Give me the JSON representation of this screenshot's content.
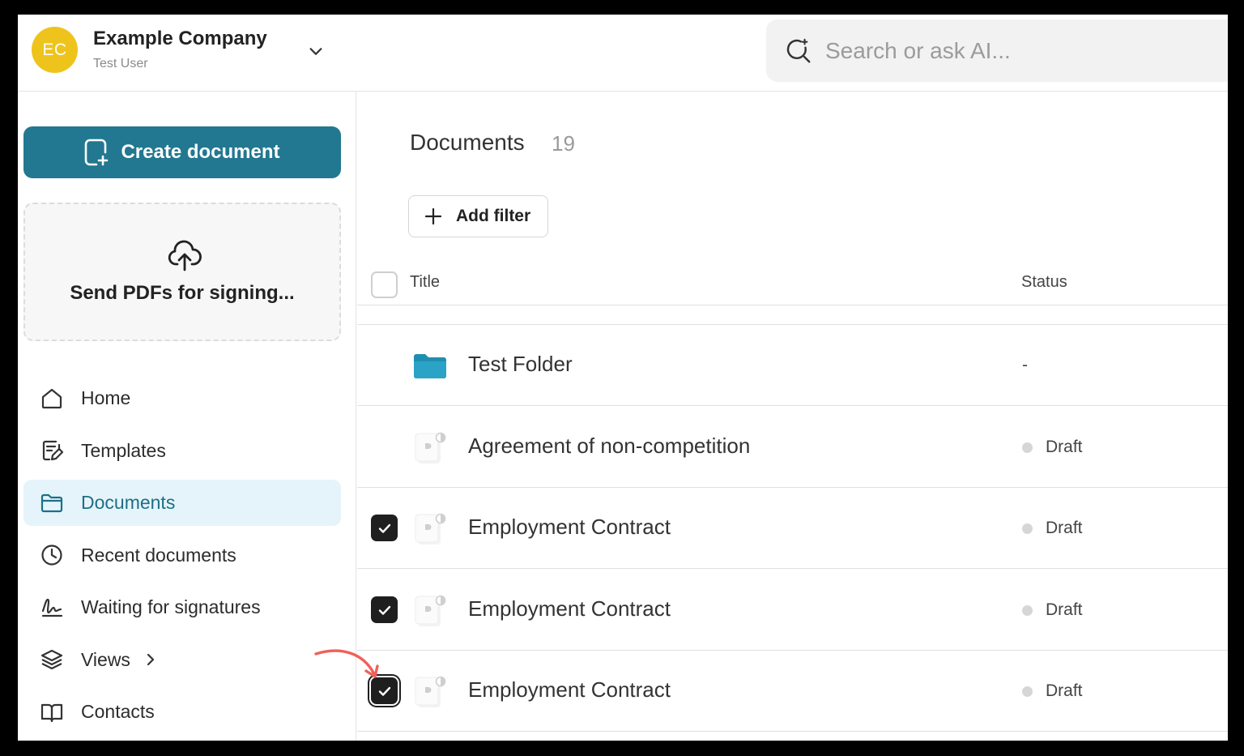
{
  "header": {
    "avatar_initials": "EC",
    "company_name": "Example Company",
    "user_name": "Test User",
    "search_placeholder": "Search or ask AI..."
  },
  "sidebar": {
    "create_label": "Create document",
    "upload_label": "Send PDFs for signing...",
    "nav": [
      {
        "label": "Home",
        "icon": "home-icon",
        "active": false
      },
      {
        "label": "Templates",
        "icon": "templates-icon",
        "active": false
      },
      {
        "label": "Documents",
        "icon": "folder-icon",
        "active": true
      },
      {
        "label": "Recent documents",
        "icon": "clock-icon",
        "active": false
      },
      {
        "label": "Waiting for signatures",
        "icon": "signature-icon",
        "active": false
      },
      {
        "label": "Views",
        "icon": "layers-icon",
        "active": false
      },
      {
        "label": "Contacts",
        "icon": "book-icon",
        "active": false
      }
    ]
  },
  "main": {
    "title": "Documents",
    "count": "19",
    "add_filter_label": "Add filter",
    "columns": {
      "title": "Title",
      "status": "Status"
    },
    "rows": [
      {
        "title": "Test Folder",
        "status": "-",
        "type": "folder",
        "checked": false
      },
      {
        "title": "Agreement of non-competition",
        "status": "Draft",
        "type": "document",
        "checked": false
      },
      {
        "title": "Employment Contract",
        "status": "Draft",
        "type": "document",
        "checked": true
      },
      {
        "title": "Employment Contract",
        "status": "Draft",
        "type": "document",
        "checked": true
      },
      {
        "title": "Employment Contract",
        "status": "Draft",
        "type": "document",
        "checked": true
      }
    ]
  },
  "colors": {
    "brand": "#227890",
    "avatar": "#eec41c",
    "active_nav_bg": "#e5f4fa",
    "folder": "#1f8fb0",
    "annotation_arrow": "#f0605a"
  }
}
